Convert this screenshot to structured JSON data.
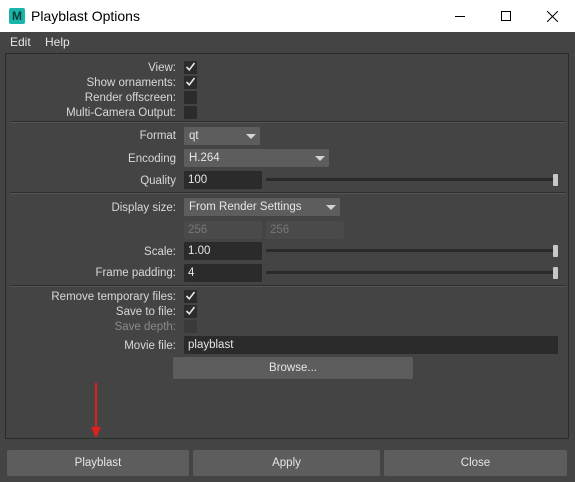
{
  "window": {
    "title": "Playblast Options",
    "icon_letter": "M",
    "icon_name": "maya-icon"
  },
  "menu": {
    "items": [
      "Edit",
      "Help"
    ]
  },
  "options": {
    "view": {
      "label": "View:",
      "checked": true
    },
    "show_ornaments": {
      "label": "Show ornaments:",
      "checked": true
    },
    "render_offscreen": {
      "label": "Render offscreen:",
      "checked": false
    },
    "multi_camera": {
      "label": "Multi-Camera Output:",
      "checked": false
    },
    "format": {
      "label": "Format",
      "value": "qt"
    },
    "encoding": {
      "label": "Encoding",
      "value": "H.264"
    },
    "quality": {
      "label": "Quality",
      "value": "100",
      "slider_fraction": 1.0
    },
    "display_size": {
      "label": "Display size:",
      "value": "From Render Settings",
      "width": "256",
      "height": "256"
    },
    "scale": {
      "label": "Scale:",
      "value": "1.00",
      "slider_fraction": 1.0
    },
    "frame_padding": {
      "label": "Frame padding:",
      "value": "4",
      "slider_fraction": 1.0
    },
    "remove_temp": {
      "label": "Remove temporary files:",
      "checked": true
    },
    "save_to_file": {
      "label": "Save to file:",
      "checked": true
    },
    "save_depth": {
      "label": "Save depth:",
      "checked": false
    },
    "movie_file": {
      "label": "Movie file:",
      "value": "playblast"
    },
    "browse_label": "Browse..."
  },
  "footer": {
    "playblast": "Playblast",
    "apply": "Apply",
    "close": "Close"
  },
  "colors": {
    "background": "#444444",
    "field": "#2b2b2b",
    "button": "#5d5d5d",
    "annotation_arrow": "#e0201c"
  }
}
